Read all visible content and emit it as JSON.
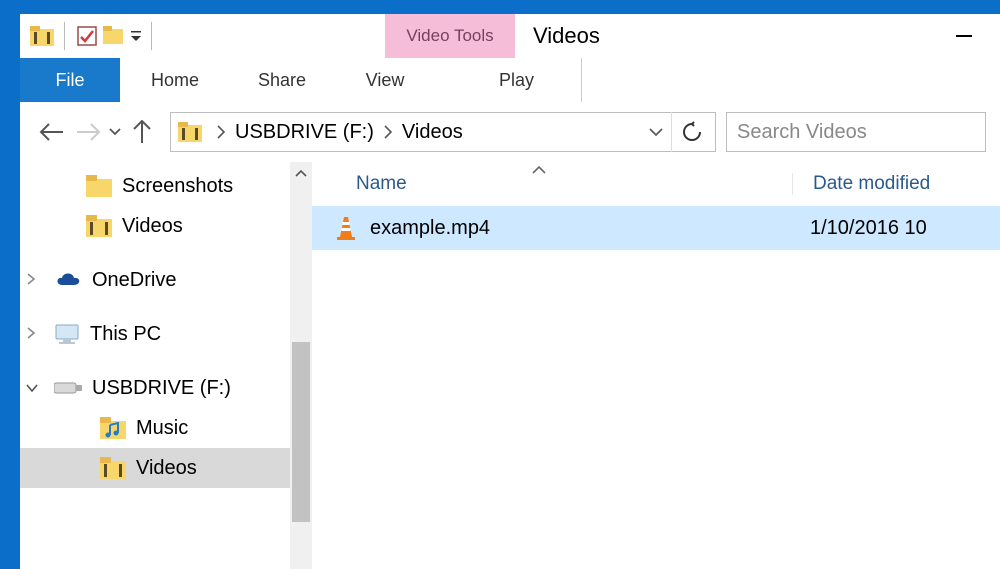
{
  "context_tab": "Video Tools",
  "window_title": "Videos",
  "ribbon": {
    "file": "File",
    "home": "Home",
    "share": "Share",
    "view": "View",
    "play": "Play"
  },
  "breadcrumb": {
    "drive": "USBDRIVE (F:)",
    "folder": "Videos"
  },
  "search_placeholder": "Search Videos",
  "navpane": {
    "screenshots": "Screenshots",
    "videos": "Videos",
    "onedrive": "OneDrive",
    "thispc": "This PC",
    "usbdrive": "USBDRIVE (F:)",
    "music": "Music",
    "videos2": "Videos"
  },
  "columns": {
    "name": "Name",
    "date": "Date modified"
  },
  "file": {
    "name": "example.mp4",
    "date": "1/10/2016 10"
  }
}
